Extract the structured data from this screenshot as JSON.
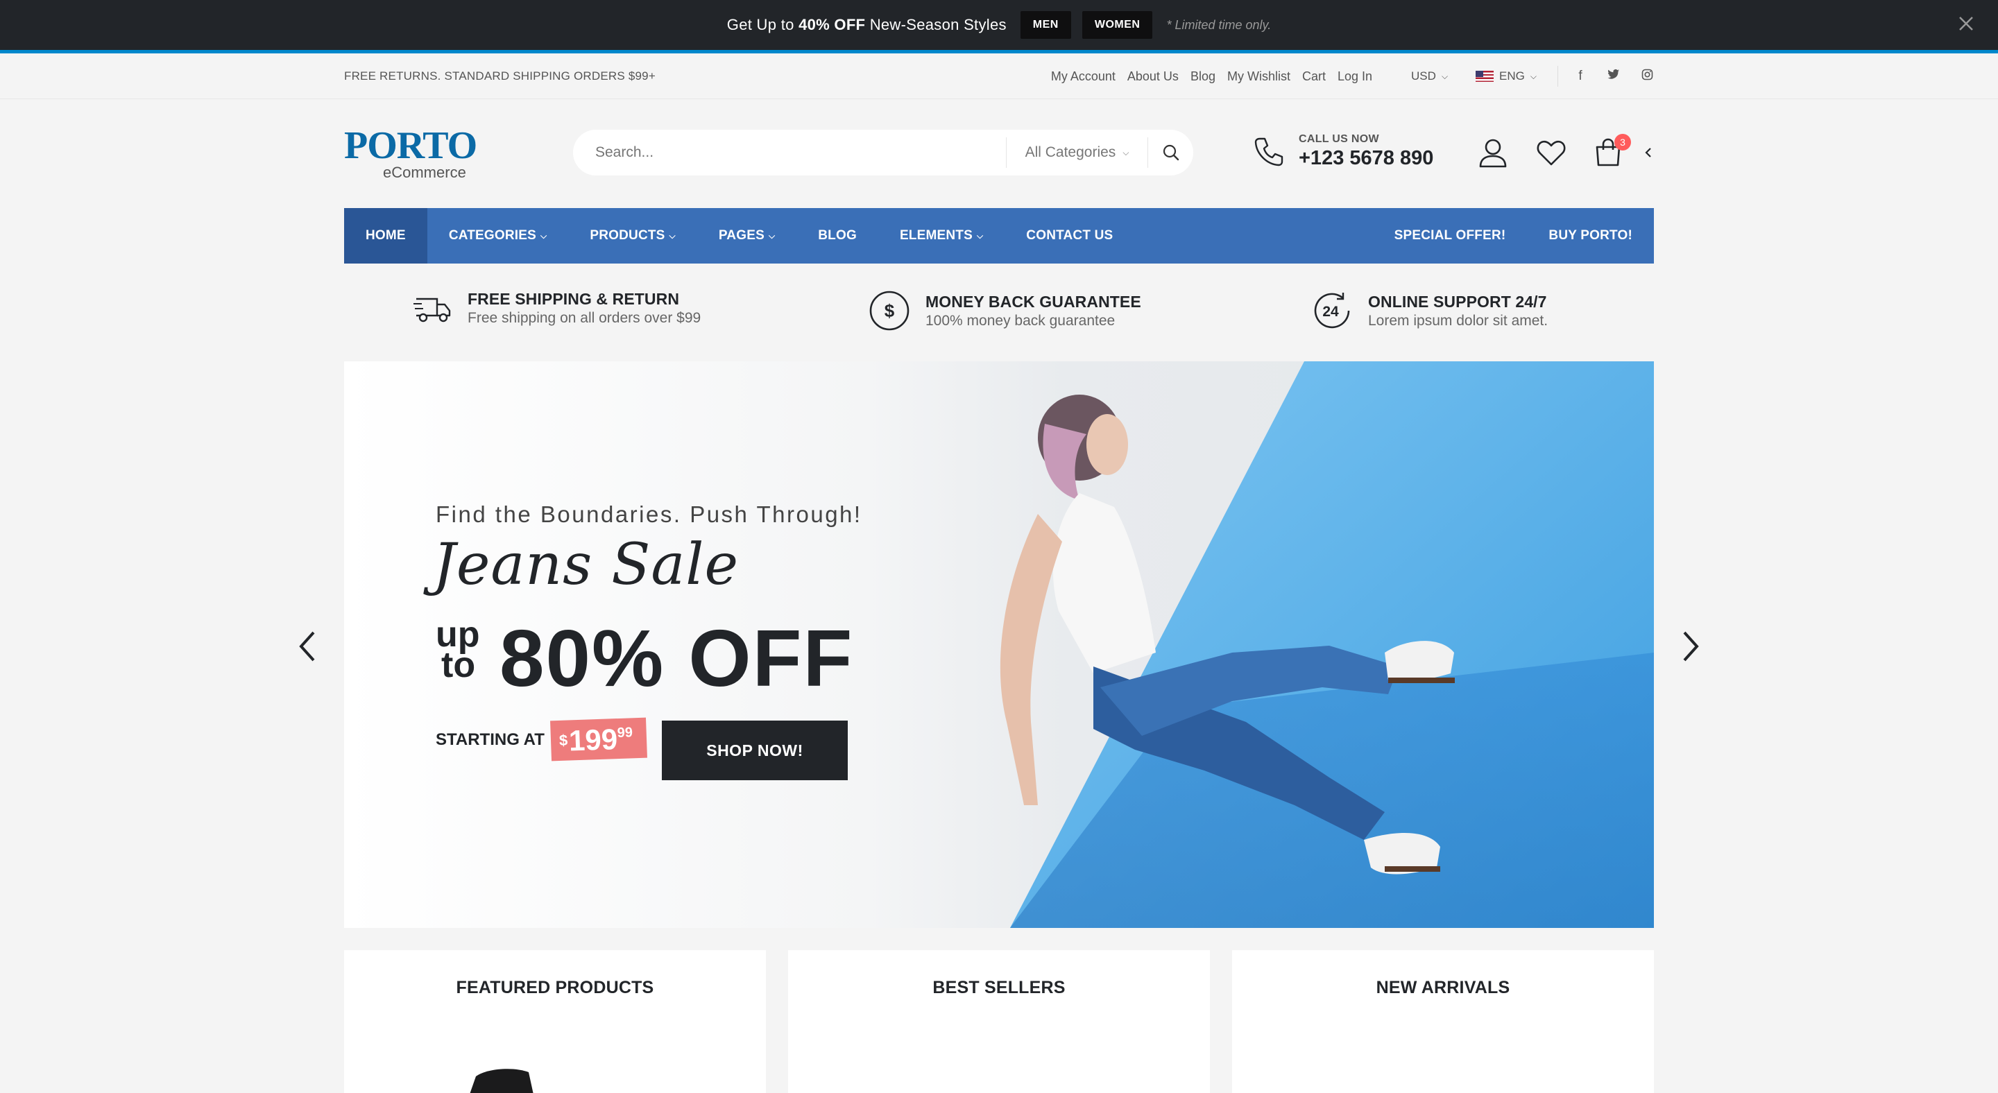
{
  "promo": {
    "text_prefix": "Get Up to ",
    "text_bold": "40% OFF",
    "text_suffix": " New-Season Styles",
    "btn_men": "MEN",
    "btn_women": "WOMEN",
    "note": "* Limited time only."
  },
  "topbar": {
    "shipping_note": "FREE RETURNS. STANDARD SHIPPING ORDERS $99+",
    "links": [
      "My Account",
      "About Us",
      "Blog",
      "My Wishlist",
      "Cart",
      "Log In"
    ],
    "currency": "USD",
    "language": "ENG"
  },
  "logo": {
    "main": "PORTO",
    "sub": "eCommerce"
  },
  "search": {
    "placeholder": "Search...",
    "category": "All Categories"
  },
  "call": {
    "label": "CALL US NOW",
    "number": "+123 5678 890"
  },
  "cart": {
    "count": "3"
  },
  "nav": {
    "items": [
      "HOME",
      "CATEGORIES",
      "PRODUCTS",
      "PAGES",
      "BLOG",
      "ELEMENTS",
      "CONTACT US"
    ],
    "right": [
      "SPECIAL OFFER!",
      "BUY PORTO!"
    ]
  },
  "features": [
    {
      "title": "FREE SHIPPING & RETURN",
      "desc": "Free shipping on all orders over $99",
      "icon": "truck-icon"
    },
    {
      "title": "MONEY BACK GUARANTEE",
      "desc": "100% money back guarantee",
      "icon": "dollar-circle-icon"
    },
    {
      "title": "ONLINE SUPPORT 24/7",
      "desc": "Lorem ipsum dolor sit amet.",
      "icon": "support-24-icon"
    }
  ],
  "hero": {
    "subtitle": "Find the Boundaries. Push Through!",
    "script": "Jeans Sale",
    "up": "up",
    "to": "to",
    "discount": "80% OFF",
    "starting": "STARTING AT",
    "price_currency": "$",
    "price_main": "199",
    "price_cents": "99",
    "cta": "SHOP NOW!"
  },
  "boxes": [
    "FEATURED PRODUCTS",
    "BEST SELLERS",
    "NEW ARRIVALS"
  ],
  "colors": {
    "primary": "#3a6fb7",
    "dark": "#222529",
    "accent_blue": "#0088cc",
    "badge": "#ff5b5b",
    "price_tag": "#ee7c7c"
  }
}
